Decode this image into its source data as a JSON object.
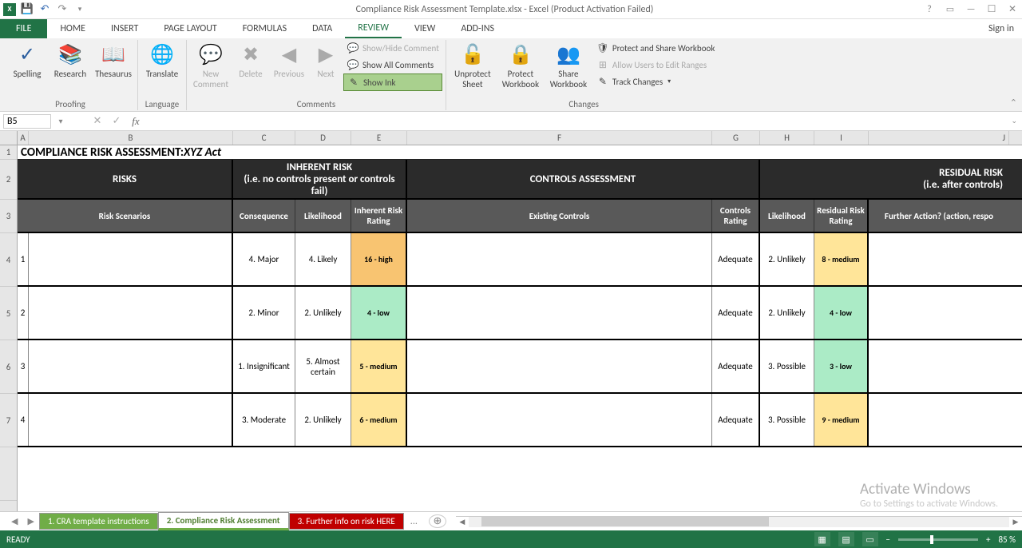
{
  "title_bar": {
    "document": "Compliance Risk Assessment Template.xlsx - Excel (Product Activation Failed)",
    "signin": "Sign in"
  },
  "tabs": [
    "FILE",
    "HOME",
    "INSERT",
    "PAGE LAYOUT",
    "FORMULAS",
    "DATA",
    "REVIEW",
    "VIEW",
    "ADD-INS"
  ],
  "active_tab": "REVIEW",
  "ribbon": {
    "proofing": {
      "label": "Proofing",
      "spelling": "Spelling",
      "research": "Research",
      "thesaurus": "Thesaurus"
    },
    "language": {
      "label": "Language",
      "translate": "Translate"
    },
    "comments": {
      "label": "Comments",
      "new": "New Comment",
      "delete": "Delete",
      "previous": "Previous",
      "next": "Next",
      "showhide": "Show/Hide Comment",
      "showall": "Show All Comments",
      "showink": "Show Ink"
    },
    "changes": {
      "label": "Changes",
      "unprotect_sheet": "Unprotect Sheet",
      "protect_wb": "Protect Workbook",
      "share_wb": "Share Workbook",
      "protect_share": "Protect and Share Workbook",
      "allow_edit": "Allow Users to Edit Ranges",
      "track": "Track Changes"
    }
  },
  "formula_bar": {
    "name_box": "B5",
    "fx": "fx"
  },
  "columns": [
    "A",
    "B",
    "C",
    "D",
    "E",
    "F",
    "G",
    "H",
    "I",
    "J"
  ],
  "sheet": {
    "title_prefix": "COMPLIANCE RISK ASSESSMENT: ",
    "title_act": "XYZ Act",
    "hdr1": {
      "risks": "RISKS",
      "inherent": "INHERENT RISK\n(i.e. no controls present or controls fail)",
      "controls": "CONTROLS ASSESSMENT",
      "residual": "RESIDUAL RISK\n(i.e. after controls)"
    },
    "hdr2": {
      "scenarios": "Risk Scenarios",
      "consequence": "Consequence",
      "likelihood": "Likelihood",
      "inherent_rating": "Inherent Risk Rating",
      "existing": "Existing Controls",
      "controls_rating": "Controls Rating",
      "likelihood2": "Likelihood",
      "residual_rating": "Residual Risk Rating",
      "further": "Further Action? (action, respo"
    },
    "rows": [
      {
        "n": "1",
        "consequence": "4. Major",
        "likelihood": "4. Likely",
        "inherent": "16 - high",
        "inherent_cls": "rating-high",
        "controls_rating": "Adequate",
        "likelihood2": "2. Unlikely",
        "residual": "8 - medium",
        "residual_cls": "rating-medium"
      },
      {
        "n": "2",
        "consequence": "2. Minor",
        "likelihood": "2. Unlikely",
        "inherent": "4 - low",
        "inherent_cls": "rating-low",
        "controls_rating": "Adequate",
        "likelihood2": "2. Unlikely",
        "residual": "4 - low",
        "residual_cls": "rating-low"
      },
      {
        "n": "3",
        "consequence": "1. Insignificant",
        "likelihood": "5. Almost certain",
        "inherent": "5 - medium",
        "inherent_cls": "rating-medium",
        "controls_rating": "Adequate",
        "likelihood2": "3. Possible",
        "residual": "3 - low",
        "residual_cls": "rating-low"
      },
      {
        "n": "4",
        "consequence": "3. Moderate",
        "likelihood": "2. Unlikely",
        "inherent": "6 - medium",
        "inherent_cls": "rating-medium",
        "controls_rating": "Adequate",
        "likelihood2": "3. Possible",
        "residual": "9 - medium",
        "residual_cls": "rating-medium"
      }
    ]
  },
  "sheet_tabs": {
    "t1": "1. CRA template instructions",
    "t2": "2. Compliance Risk Assessment",
    "t3": "3. Further info on risk HERE",
    "dots": "..."
  },
  "status": {
    "ready": "READY",
    "zoom": "85 %"
  },
  "watermark": {
    "title": "Activate Windows",
    "sub": "Go to Settings to activate Windows."
  }
}
